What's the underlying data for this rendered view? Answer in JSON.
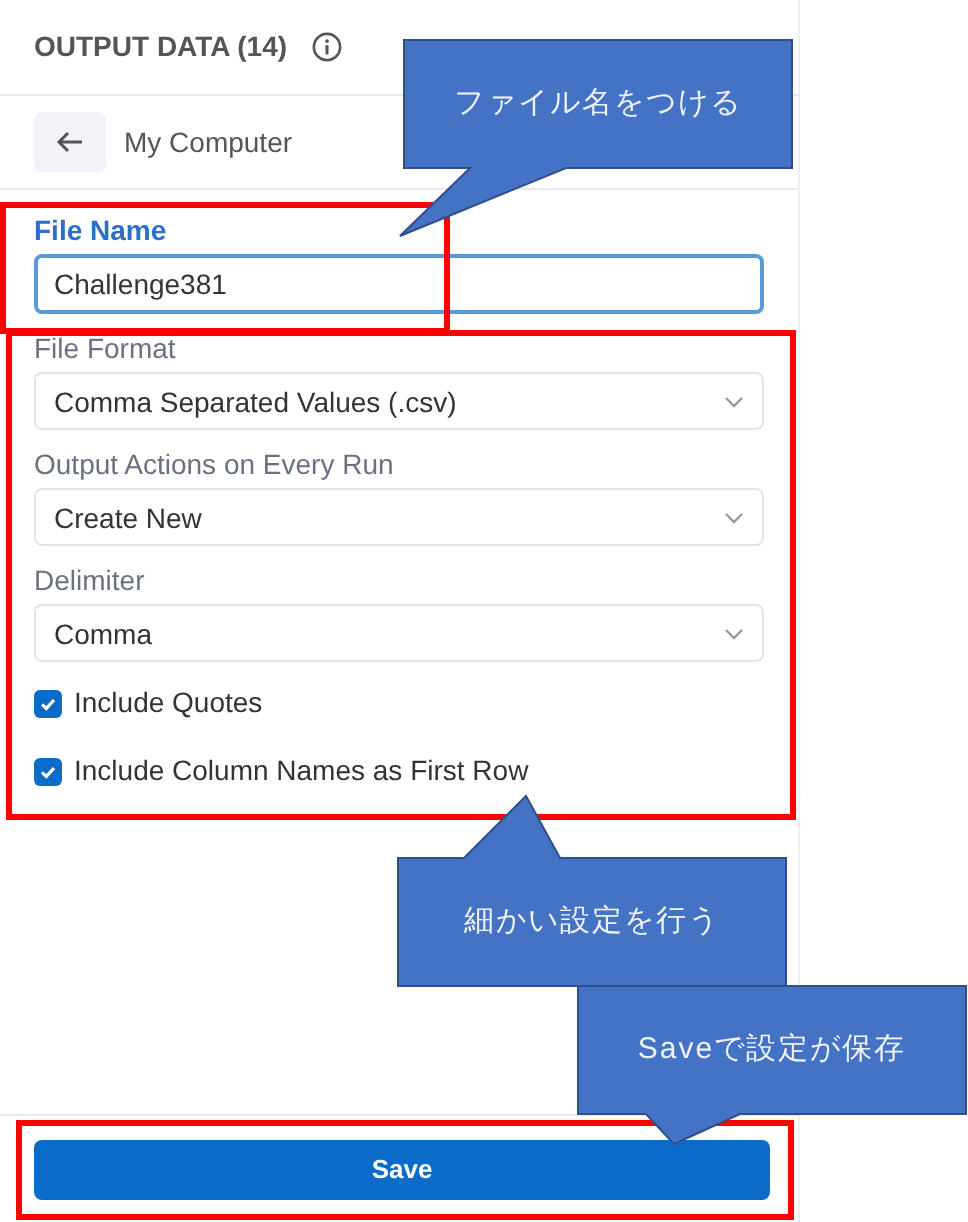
{
  "panel": {
    "title": "OUTPUT DATA (14)",
    "location": "My Computer",
    "fields": [
      {
        "kind": "text",
        "label": "File Name",
        "value": "Challenge381",
        "focused": true
      },
      {
        "kind": "select",
        "label": "File Format",
        "value": "Comma Separated Values (.csv)",
        "focused": false
      },
      {
        "kind": "select",
        "label": "Output Actions on Every Run",
        "value": "Create New",
        "focused": false
      },
      {
        "kind": "select",
        "label": "Delimiter",
        "value": "Comma",
        "focused": false
      }
    ],
    "checkboxes": [
      {
        "label": "Include Quotes",
        "checked": true
      },
      {
        "label": "Include Column Names as First Row",
        "checked": true
      }
    ],
    "save_button": "Save"
  },
  "callouts": [
    "ファイル名をつける",
    "細かい設定を行う",
    "Saveで設定が保存"
  ]
}
